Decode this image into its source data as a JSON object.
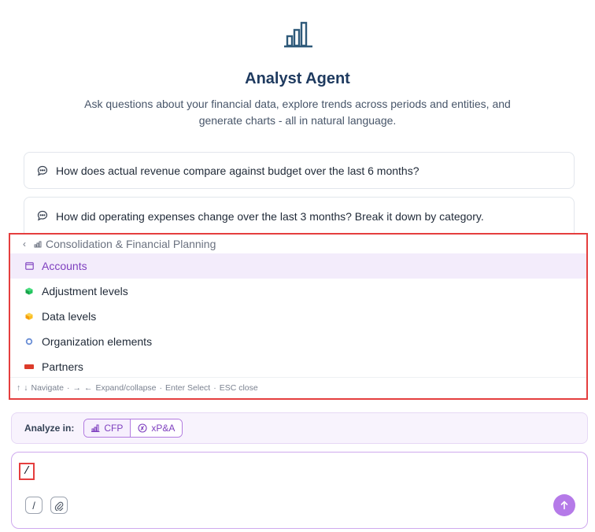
{
  "header": {
    "icon": "bar-chart-icon",
    "title": "Analyst Agent",
    "subtitle": "Ask questions about your financial data, explore trends across periods and entities, and generate charts - all in natural language."
  },
  "suggestions": [
    {
      "icon": "chat-bubble-icon",
      "text": "How does actual revenue compare against budget over the last 6 months?"
    },
    {
      "icon": "chat-bubble-icon",
      "text": "How did operating expenses change over the last 3 months? Break it down by category."
    }
  ],
  "dropdown": {
    "breadcrumb": "Consolidation & Financial Planning",
    "items": [
      {
        "label": "Accounts",
        "icon": "table-icon",
        "selected": true
      },
      {
        "label": "Adjustment levels",
        "icon": "green-cube-icon",
        "selected": false
      },
      {
        "label": "Data levels",
        "icon": "orange-cube-icon",
        "selected": false
      },
      {
        "label": "Organization elements",
        "icon": "circle-icon",
        "selected": false
      },
      {
        "label": "Partners",
        "icon": "red-flag-icon",
        "selected": false
      }
    ],
    "footer": {
      "navigate": "Navigate",
      "expand": "Expand/collapse",
      "select": "Enter Select",
      "close": "ESC close",
      "separator": "·"
    }
  },
  "analyze": {
    "label": "Analyze in:",
    "options": [
      {
        "label": "CFP",
        "icon": "bar-chart-icon",
        "active": true
      },
      {
        "label": "xP&A",
        "icon": "xpa-logo-icon",
        "active": false
      }
    ]
  },
  "composer": {
    "value": "/",
    "slash_label": "/",
    "attach_icon": "paperclip-icon",
    "send_icon": "arrow-up-icon"
  },
  "colors": {
    "accent": "#b57ae8",
    "accent_text": "#7e3fbf",
    "title": "#1e3a5f",
    "highlight_border": "#e53e3e"
  }
}
